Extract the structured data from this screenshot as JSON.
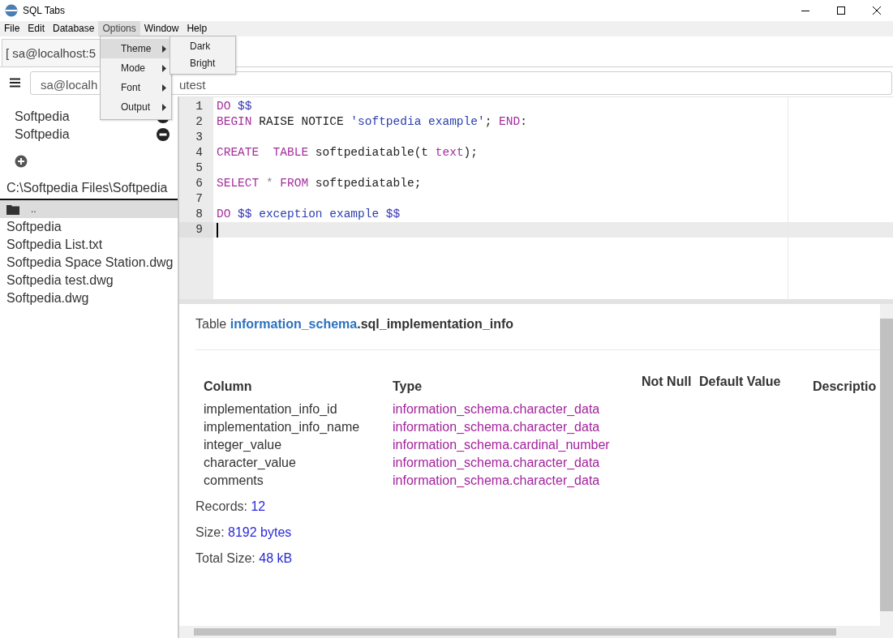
{
  "window": {
    "title": "SQL Tabs"
  },
  "menubar": [
    {
      "label": "File",
      "selected": false
    },
    {
      "label": "Edit",
      "selected": false
    },
    {
      "label": "Database",
      "selected": false
    },
    {
      "label": "Options",
      "selected": true
    },
    {
      "label": "Window",
      "selected": false
    },
    {
      "label": "Help",
      "selected": false
    }
  ],
  "open_menu": {
    "items": [
      {
        "label": "Theme",
        "selected": true
      },
      {
        "label": "Mode",
        "selected": false
      },
      {
        "label": "Font",
        "selected": false
      },
      {
        "label": "Output",
        "selected": false
      }
    ],
    "submenu": [
      {
        "label": "Dark"
      },
      {
        "label": "Bright"
      }
    ]
  },
  "tabs": [
    {
      "label": "[ sa@localhost:5"
    }
  ],
  "connection_field": {
    "value_start": "sa@localh",
    "value_end": "utest"
  },
  "connections": [
    {
      "label": "Softpedia"
    },
    {
      "label": "Softpedia"
    }
  ],
  "current_path": "C:\\Softpedia Files\\Softpedia",
  "files": [
    {
      "name": "..",
      "kind": "folder",
      "selected": true
    },
    {
      "name": "Softpedia",
      "kind": "file",
      "selected": false
    },
    {
      "name": "Softpedia List.txt",
      "kind": "file",
      "selected": false
    },
    {
      "name": "Softpedia Space Station.dwg",
      "kind": "file",
      "selected": false
    },
    {
      "name": "Softpedia test.dwg",
      "kind": "file",
      "selected": false
    },
    {
      "name": "Softpedia.dwg",
      "kind": "file",
      "selected": false
    }
  ],
  "editor": {
    "lines": [
      {
        "number": "1",
        "current": false,
        "tokens": [
          {
            "text": "DO",
            "kind": "keyword"
          },
          {
            "text": " $$",
            "kind": "dollar"
          }
        ]
      },
      {
        "number": "2",
        "current": false,
        "tokens": [
          {
            "text": "BEGIN",
            "kind": "keyword"
          },
          {
            "text": " RAISE NOTICE",
            "kind": "plain"
          },
          {
            "text": " 'softpedia example'",
            "kind": "string"
          },
          {
            "text": ";",
            "kind": "plain"
          },
          {
            "text": " END",
            "kind": "keyword"
          },
          {
            "text": ":",
            "kind": "plain"
          }
        ]
      },
      {
        "number": "3",
        "current": false
      },
      {
        "number": "4",
        "current": false,
        "tokens": [
          {
            "text": "CREATE",
            "kind": "keyword"
          },
          {
            "text": "  TABLE",
            "kind": "keyword"
          },
          {
            "text": " softpediatable(t",
            "kind": "plain"
          },
          {
            "text": " text",
            "kind": "keyword"
          },
          {
            "text": ");",
            "kind": "plain"
          }
        ]
      },
      {
        "number": "5",
        "current": false
      },
      {
        "number": "6",
        "current": false,
        "tokens": [
          {
            "text": "SELECT",
            "kind": "keyword"
          },
          {
            "text": " *",
            "kind": "operator"
          },
          {
            "text": " FROM",
            "kind": "keyword"
          },
          {
            "text": " softpediatable;",
            "kind": "plain"
          }
        ]
      },
      {
        "number": "7",
        "current": false
      },
      {
        "number": "8",
        "current": false,
        "tokens": [
          {
            "text": "DO",
            "kind": "keyword"
          },
          {
            "text": " $$",
            "kind": "dollar"
          },
          {
            "text": " exception example",
            "kind": "string"
          },
          {
            "text": " $$",
            "kind": "dollar"
          }
        ]
      },
      {
        "number": "9",
        "current": true
      }
    ]
  },
  "info": {
    "title_prefix": "Table",
    "schema": "information_schema",
    "table_name": ".sql_implementation_info",
    "columns": [
      "Column",
      "Type",
      "Not Null",
      "Default Value",
      "Descriptio"
    ],
    "rows": [
      {
        "column": "implementation_info_id",
        "type": "information_schema.character_data"
      },
      {
        "column": "implementation_info_name",
        "type": "information_schema.character_data"
      },
      {
        "column": "integer_value",
        "type": "information_schema.cardinal_number"
      },
      {
        "column": "character_value",
        "type": "information_schema.character_data"
      },
      {
        "column": "comments",
        "type": "information_schema.character_data"
      }
    ],
    "stats": [
      {
        "label": "Records:",
        "value": "12"
      },
      {
        "label": "Size:",
        "value": "8192 bytes"
      },
      {
        "label": "Total Size:",
        "value": "48 kB"
      }
    ]
  }
}
